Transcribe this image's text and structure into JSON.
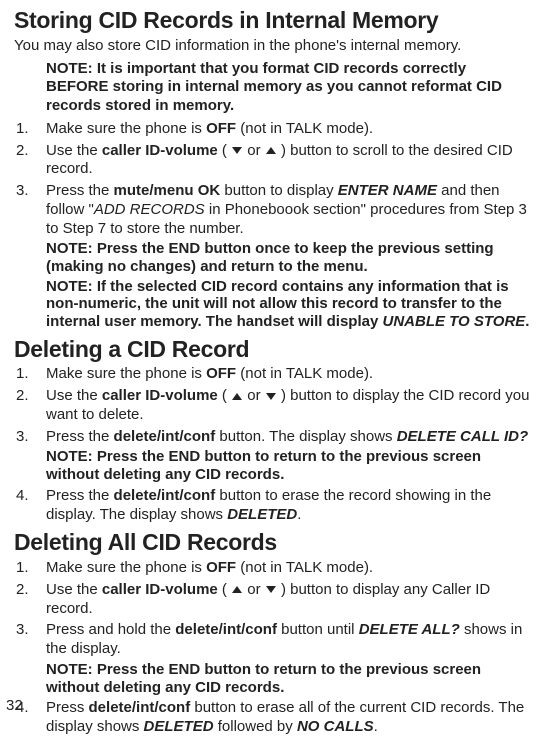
{
  "section1": {
    "heading": "Storing CID Records in Internal Memory",
    "intro": "You may also store CID information in the phone's internal memory.",
    "note": "NOTE: It is important that you format CID records correctly BEFORE storing in internal memory as you cannot reformat CID records stored in memory.",
    "steps": {
      "s1_pre": "Make sure the phone is ",
      "s1_b": "OFF",
      "s1_post": " (not in TALK mode).",
      "s2_pre": "Use the ",
      "s2_b": "caller ID-volume",
      "s2_paren_open": " ( ",
      "s2_or": " or ",
      "s2_paren_close": " ) button to scroll to the desired CID record.",
      "s3_pre": "Press the ",
      "s3_b": "mute/menu OK",
      "s3_mid": " button to display ",
      "s3_bi": "ENTER NAME",
      "s3_mid2": " and then follow \"",
      "s3_i": "ADD RECORDS",
      "s3_post": " in Phoneboook section\" procedures from Step 3 to Step 7 to store the number.",
      "s3_note1": "NOTE: Press the END button once to keep the previous setting (making no changes) and return to the menu.",
      "s3_note2_a": "NOTE: If the selected CID record contains any information that is non-numeric, the unit will not allow this record to transfer to the internal user memory. The handset will display ",
      "s3_note2_bi": "UNABLE TO STORE",
      "s3_note2_dot": "."
    }
  },
  "section2": {
    "heading": "Deleting a CID Record",
    "steps": {
      "s1_pre": "Make sure the phone is ",
      "s1_b": "OFF",
      "s1_post": " (not in TALK mode).",
      "s2_pre": "Use the ",
      "s2_b": "caller ID-volume",
      "s2_paren_open": " ( ",
      "s2_or": " or ",
      "s2_paren_close": " ) button to display the CID record you want to delete.",
      "s3_pre": "Press the ",
      "s3_b": "delete/int/conf",
      "s3_mid": " button. The display shows ",
      "s3_bi": "DELETE CALL ID?",
      "s3_note": "NOTE: Press the END button to return to the previous screen without deleting any CID records.",
      "s4_pre": "Press the ",
      "s4_b": "delete/int/conf",
      "s4_mid": " button to erase the record showing in the display. The display shows ",
      "s4_bi": "DELETED",
      "s4_dot": "."
    }
  },
  "section3": {
    "heading": "Deleting All CID Records",
    "steps": {
      "s1_pre": "Make sure the phone is ",
      "s1_b": "OFF",
      "s1_post": " (not in TALK mode).",
      "s2_pre": "Use the  ",
      "s2_b": "caller ID-volume",
      "s2_paren_open": " ( ",
      "s2_or": " or ",
      "s2_paren_close": " ) button to display any Caller ID record.",
      "s3_pre": "Press and hold the ",
      "s3_b": "delete/int/conf",
      "s3_mid": " button until ",
      "s3_bi": "DELETE ALL?",
      "s3_post": " shows in the display.",
      "s3_note": "NOTE: Press the END button to return to the previous screen without deleting any CID records.",
      "s4_pre": "Press ",
      "s4_b": "delete/int/conf",
      "s4_mid": " button to erase all of the current CID records. The display shows ",
      "s4_bi1": "DELETED",
      "s4_mid2": " followed by ",
      "s4_bi2": "NO CALLS",
      "s4_dot": "."
    }
  },
  "page_number": "32",
  "nums": {
    "n1": "1.",
    "n2": "2.",
    "n3": "3.",
    "n4": "4."
  }
}
